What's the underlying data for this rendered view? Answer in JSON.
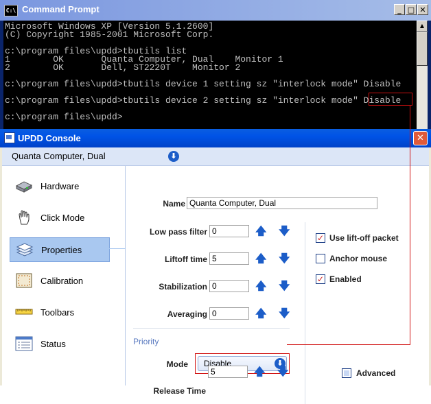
{
  "cmd": {
    "title": "Command Prompt",
    "icon_text": "C:\\",
    "lines": [
      "Microsoft Windows XP [Version 5.1.2600]",
      "(C) Copyright 1985-2001 Microsoft Corp.",
      "",
      "c:\\program files\\updd>tbutils list",
      "1        OK       Quanta Computer, Dual    Monitor 1",
      "2        OK       Dell, ST2220T    Monitor 2",
      "",
      "c:\\program files\\updd>tbutils device 1 setting sz \"interlock mode\" Disable",
      "",
      "c:\\program files\\updd>tbutils device 2 setting sz \"interlock mode\" Disable",
      "",
      "c:\\program files\\updd>"
    ],
    "buttons": {
      "minimize": "_",
      "maximize": "□",
      "close": "✕"
    }
  },
  "console": {
    "title": "UPDD Console",
    "close": "✕",
    "device": "Quanta Computer, Dual",
    "sidebar": [
      {
        "label": "Hardware",
        "icon": "hardware-icon"
      },
      {
        "label": "Click Mode",
        "icon": "hand-pointer-icon"
      },
      {
        "label": "Properties",
        "icon": "layers-icon"
      },
      {
        "label": "Calibration",
        "icon": "calibration-icon"
      },
      {
        "label": "Toolbars",
        "icon": "ruler-icon"
      },
      {
        "label": "Status",
        "icon": "status-list-icon"
      }
    ],
    "selected_item": "Properties",
    "name_label": "Name",
    "name_value": "Quanta Computer, Dual",
    "settings": [
      {
        "label": "Low pass filter",
        "value": "0"
      },
      {
        "label": "Liftoff time",
        "value": "5"
      },
      {
        "label": "Stabilization",
        "value": "0"
      },
      {
        "label": "Averaging",
        "value": "0"
      }
    ],
    "options": [
      {
        "label": "Use lift-off packet",
        "checked": true
      },
      {
        "label": "Anchor mouse",
        "checked": false
      },
      {
        "label": "Enabled",
        "checked": true
      }
    ],
    "priority_label": "Priority",
    "mode_label": "Mode",
    "mode_value": "Disable",
    "release_label": "Release Time",
    "release_value": "5",
    "advanced_label": "Advanced",
    "colors": {
      "accent": "#1c5dc8",
      "highlight": "#d01010",
      "selected": "#a9c8f0"
    }
  }
}
